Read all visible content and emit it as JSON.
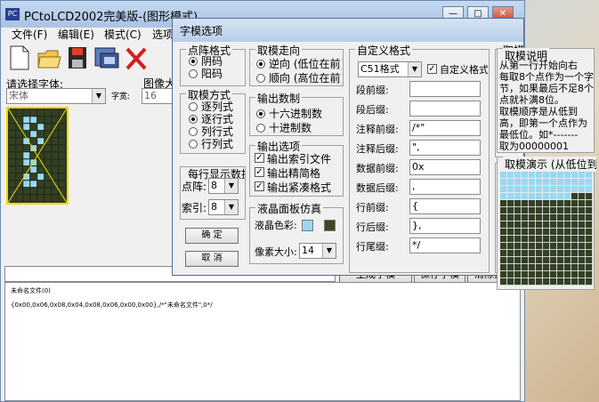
{
  "main_window": {
    "title": "PCtoLCD2002完美版-(图形模式)",
    "app_icon": "PC",
    "controls": {
      "minimize": "—",
      "maximize": "□",
      "close": "✕"
    },
    "menu": [
      "文件(F)",
      "编辑(E)",
      "模式(C)",
      "选项"
    ],
    "font_label": "请选择字体:",
    "font_value": "宋体",
    "size_label": "字宽:",
    "image_label": "图像大",
    "image_value": "16",
    "buttons": {
      "generate": "生成字模",
      "save": "保存字模",
      "clear": "清除数据"
    },
    "output_line1": "未命名文件(0)",
    "output_line2": "{0x00,0x06,0x08,0x04,0x08,0x06,0x00,0x00},/*\"未命名文件\",0*/"
  },
  "dialog": {
    "title": "字模选项",
    "dot_format": {
      "title": "点阵格式",
      "options": [
        "阴码",
        "阳码"
      ],
      "selected": 0
    },
    "scan_mode": {
      "title": "取模方式",
      "options": [
        "逐列式",
        "逐行式",
        "列行式",
        "行列式"
      ],
      "selected": 1
    },
    "per_row": {
      "title": "每行显示数据",
      "dots_label": "点阵:",
      "dots_value": "8",
      "index_label": "索引:",
      "index_value": "8"
    },
    "ok": "确   定",
    "cancel": "取   消",
    "direction": {
      "title": "取模走向",
      "options": [
        "逆向 (低位在前)",
        "顺向 (高位在前)"
      ],
      "selected": 0
    },
    "base": {
      "title": "输出数制",
      "options": [
        "十六进制数",
        "十进制数"
      ],
      "selected": 0
    },
    "output_opts": {
      "title": "输出选项",
      "items": [
        {
          "label": "输出索引文件",
          "checked": true
        },
        {
          "label": "输出精简格",
          "checked": true
        },
        {
          "label": "输出紧凑格式",
          "checked": true
        }
      ]
    },
    "lcd": {
      "title": "液晶面板仿真",
      "color_label": "液晶色彩:",
      "pixel_label": "像素大小:",
      "pixel_value": "14",
      "on_color": "#9ad9f0",
      "off_color": "#3a4a20"
    },
    "custom": {
      "title": "自定义格式",
      "format_value": "C51格式",
      "custom_check_label": "自定义格式",
      "fields": [
        {
          "label": "段前缀:",
          "value": ""
        },
        {
          "label": "段后缀:",
          "value": ""
        },
        {
          "label": "注释前缀:",
          "value": "/*\""
        },
        {
          "label": "注释后缀:",
          "value": "\","
        },
        {
          "label": "数据前缀:",
          "value": "0x"
        },
        {
          "label": "数据后缀:",
          "value": ","
        },
        {
          "label": "行前缀:",
          "value": "{"
        },
        {
          "label": "行后缀:",
          "value": "},"
        },
        {
          "label": "行尾缀:",
          "value": "*/"
        }
      ]
    },
    "explanation": {
      "title": "取模说明",
      "lines": [
        "从第一行开始向右",
        "每取8个点作为一个字",
        "节，如果最后不足8个",
        "点就补满8位。",
        "取模顺序是从低到",
        "高，即第一个点作为",
        "最低位。如*-------",
        "取为00000001"
      ]
    },
    "demo": {
      "title": "取模演示 (从低位到"
    }
  },
  "colors": {
    "lcd_on": "#9ad9f0",
    "lcd_off": "#334025",
    "highlight": "#f0d800"
  }
}
